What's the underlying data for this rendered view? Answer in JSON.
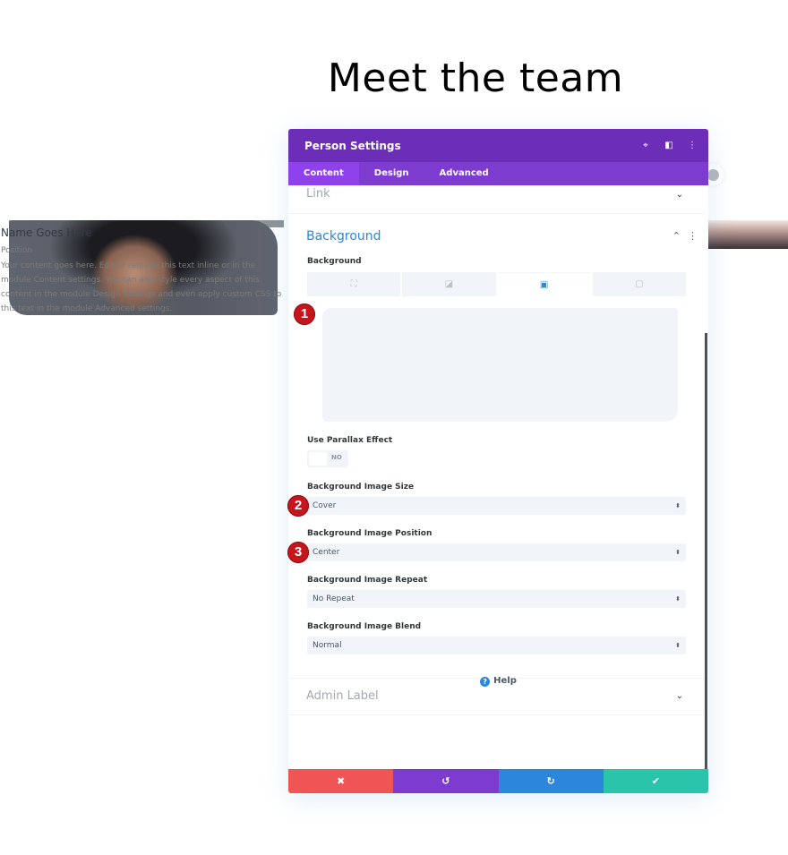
{
  "page": {
    "title": "Meet the team"
  },
  "person_module": {
    "name": "Name Goes Here",
    "position": "Position",
    "body": "Your content goes here. Edit or remove this text inline or in the module Content settings. You can also style every aspect of this content in the module Design settings and even apply custom CSS to this text in the module Advanced settings."
  },
  "modal": {
    "title": "Person Settings",
    "header_icons": [
      "focus-icon",
      "split-view-icon",
      "more-options-icon"
    ],
    "tabs": [
      {
        "label": "Content",
        "active": true
      },
      {
        "label": "Design",
        "active": false
      },
      {
        "label": "Advanced",
        "active": false
      }
    ],
    "link_section": {
      "title": "Link",
      "expanded": false
    },
    "background_section": {
      "title": "Background",
      "expanded": true,
      "background_label": "Background",
      "bg_type_tabs": [
        {
          "icon": "paint-bucket-icon",
          "active": false
        },
        {
          "icon": "gradient-icon",
          "active": false
        },
        {
          "icon": "image-icon",
          "active": true
        },
        {
          "icon": "video-icon",
          "active": false
        }
      ],
      "parallax": {
        "label": "Use Parallax Effect",
        "value": "NO"
      },
      "image_size": {
        "label": "Background Image Size",
        "value": "Cover"
      },
      "image_position": {
        "label": "Background Image Position",
        "value": "Center"
      },
      "image_repeat": {
        "label": "Background Image Repeat",
        "value": "No Repeat"
      },
      "image_blend": {
        "label": "Background Image Blend",
        "value": "Normal"
      }
    },
    "admin_label_section": {
      "title": "Admin Label",
      "expanded": false
    },
    "help_label": "Help",
    "footer": {
      "cancel_icon": "✖",
      "undo_icon": "↺",
      "redo_icon": "↻",
      "save_icon": "✔"
    }
  },
  "annotations": [
    "1",
    "2",
    "3"
  ],
  "colors": {
    "header": "#6c2eb9",
    "tabs": "#7d3bcf",
    "accent_blue": "#2b87da",
    "cancel": "#ef5555",
    "undo": "#7e3bd0",
    "redo": "#2b87da",
    "save": "#29c4a9",
    "annotation_red": "#c5161d"
  }
}
